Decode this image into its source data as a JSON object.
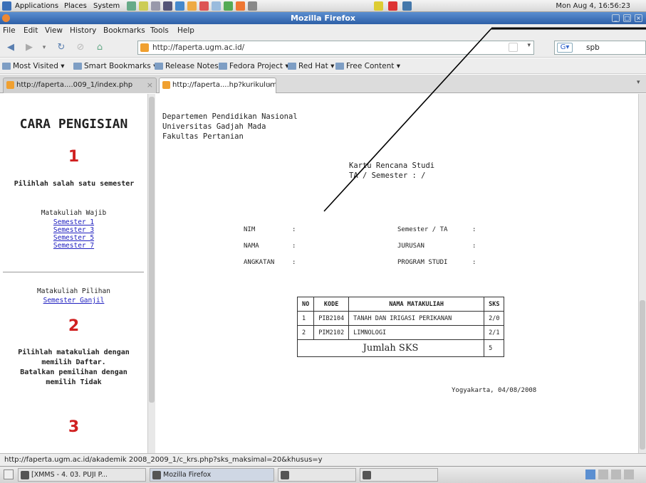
{
  "top_panel": {
    "menus": [
      "Applications",
      "Places",
      "System"
    ],
    "clock": "Mon Aug  4, 16:56:23"
  },
  "window": {
    "title": "Mozilla Firefox"
  },
  "menu_bar": [
    "File",
    "Edit",
    "View",
    "History",
    "Bookmarks",
    "Tools",
    "Help"
  ],
  "nav": {
    "url": "http://faperta.ugm.ac.id/",
    "search_value": "spb"
  },
  "bookmarks": [
    "Most Visited",
    "Smart Bookmarks",
    "Release Notes",
    "Fedora Project",
    "Red Hat",
    "Free Content"
  ],
  "tabs": [
    {
      "label": "http://faperta....009_1/index.php"
    },
    {
      "label": "http://faperta....hp?kurikulum=2"
    }
  ],
  "left": {
    "heading": "CARA PENGISIAN",
    "step1": "1",
    "step1_text": "Pilihlah salah satu semester",
    "wajib_label": "Matakuliah Wajib",
    "wajib_links": [
      "Semester 1",
      "Semester 3",
      "Semester 5",
      "Semester 7"
    ],
    "pilihan_label": "Matakuliah Pilihan",
    "pilihan_link": "Semester Ganjil",
    "step2": "2",
    "step2_line1": "Pilihlah matakuliah dengan",
    "step2_line2": "memilih Daftar.",
    "step2_line3": "Batalkan pemilihan dengan",
    "step2_line4": "memilih Tidak",
    "step3": "3"
  },
  "right": {
    "org1": "Departemen Pendidikan Nasional",
    "org2": "Universitas Gadjah Mada",
    "org3": "Fakultas Pertanian",
    "doc_title": "Kartu Rencana Studi",
    "doc_sub": "TA / Semester :  /",
    "fields_left": [
      "NIM",
      "NAMA",
      "ANGKATAN"
    ],
    "fields_right": [
      "Semester / TA",
      "JURUSAN",
      "PROGRAM STUDI"
    ],
    "colon": ":",
    "table": {
      "headers": [
        "NO",
        "KODE",
        "NAMA MATAKULIAH",
        "SKS"
      ],
      "rows": [
        [
          "1",
          "PIB2104",
          "TANAH DAN IRIGASI PERIKANAN",
          "2/0"
        ],
        [
          "2",
          "PIM2102",
          "LIMNOLOGI",
          "2/1"
        ]
      ],
      "total_label": "Jumlah SKS",
      "total_value": "5"
    },
    "place_date": "Yogyakarta, 04/08/2008"
  },
  "status": "http://faperta.ugm.ac.id/akademik 2008_2009_1/c_krs.php?sks_maksimal=20&khusus=y",
  "taskbar": [
    "[XMMS - 4. 03. PUJI P...",
    "Mozilla Firefox",
    "",
    ""
  ]
}
